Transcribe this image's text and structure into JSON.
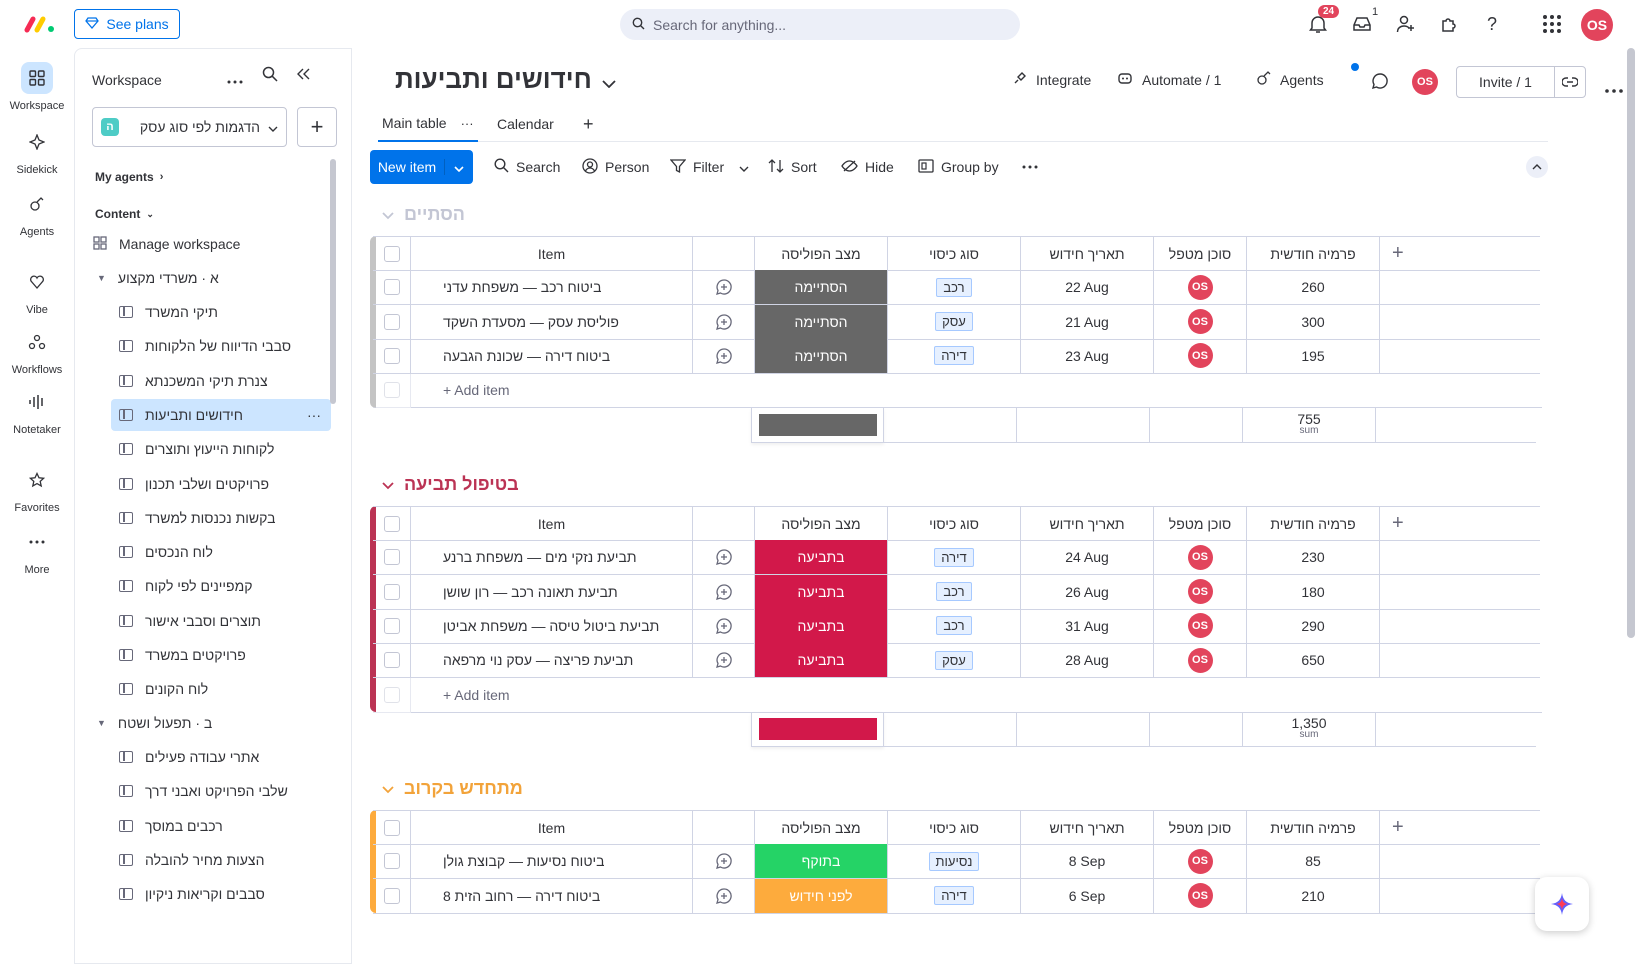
{
  "topbar": {
    "see_plans": "See plans",
    "search_placeholder": "Search for anything...",
    "notif_count": "24",
    "inbox_count": "1",
    "avatar": "OS"
  },
  "leftnav": [
    {
      "label": "Workspace",
      "icon": "workspace-icon"
    },
    {
      "label": "Sidekick",
      "icon": "sidekick-icon"
    },
    {
      "label": "Agents",
      "icon": "agents-icon"
    },
    {
      "label": "Vibe",
      "icon": "vibe-icon"
    },
    {
      "label": "Workflows",
      "icon": "workflows-icon"
    },
    {
      "label": "Notetaker",
      "icon": "notetaker-icon"
    },
    {
      "label": "Favorites",
      "icon": "star-icon"
    },
    {
      "label": "More",
      "icon": "more-icon"
    }
  ],
  "sidebar": {
    "title": "Workspace",
    "workspace_badge": "ה",
    "workspace_name": "הדגמות לפי סוג עסק",
    "my_agents": "My agents",
    "content": "Content",
    "manage": "Manage workspace",
    "folder_a": "א · משרדי מקצוע",
    "folder_b": "ב · תפעול ושטח",
    "items": [
      "תיקי המשרד",
      "סבבי הדיווח של הלקוחות",
      "צנרת תיקי המשכנתא",
      "חידושים ותביעות",
      "לקוחות הייעוץ ותוצרים",
      "פרויקטים ושלבי תכנון",
      "בקשות נכנסות למשרד",
      "לוח הנכסים",
      "קמפיינים לפי לקוח",
      "תוצרים וסבבי אישור",
      "פרויקטים במשרד",
      "לוח הקונים"
    ],
    "items_b": [
      "אתרי עבודה פעילים",
      "שלבי הפרויקט ואבני דרך",
      "רכבים במוסך",
      "הצעות מחיר להובלה",
      "סבבים וקריאות ניקיון"
    ]
  },
  "board": {
    "title": "חידושים ותביעות",
    "integrate": "Integrate",
    "automate": "Automate / 1",
    "agents": "Agents",
    "invite": "Invite / 1",
    "tabs": [
      "Main table",
      "Calendar"
    ],
    "toolbar": {
      "new_item": "New item",
      "search": "Search",
      "person": "Person",
      "filter": "Filter",
      "sort": "Sort",
      "hide": "Hide",
      "group_by": "Group by"
    },
    "columns": [
      "Item",
      "מצב הפוליסה",
      "סוג כיסוי",
      "תאריך חידוש",
      "סוכן מטפל",
      "פרמיה חודשית"
    ],
    "add_item": "+ Add item",
    "sum_label": "sum"
  },
  "groups": [
    {
      "name": "הסתיים",
      "color": "#c4c4c4",
      "title_color": "#c3c6d4",
      "sum": "755",
      "rows": [
        {
          "item": "ביטוח רכב — משפחת עדני",
          "status": "הסתיימה",
          "status_color": "#676767",
          "type": "רכב",
          "date": "22 Aug",
          "owner": "OS",
          "premium": "260"
        },
        {
          "item": "פוליסת עסק — מסעדת השקד",
          "status": "הסתיימה",
          "status_color": "#676767",
          "type": "עסק",
          "date": "21 Aug",
          "owner": "OS",
          "premium": "300"
        },
        {
          "item": "ביטוח דירה — שכונת הגבעה",
          "status": "הסתיימה",
          "status_color": "#676767",
          "type": "דירה",
          "date": "23 Aug",
          "owner": "OS",
          "premium": "195"
        }
      ]
    },
    {
      "name": "בטיפול תביעה",
      "color": "#bb3354",
      "title_color": "#bb3354",
      "sum": "1,350",
      "rows": [
        {
          "item": "תביעת נזקי מים — משפחת ברנע",
          "status": "בתביעה",
          "status_color": "#d2184a",
          "type": "דירה",
          "date": "24 Aug",
          "owner": "OS",
          "premium": "230"
        },
        {
          "item": "תביעת תאונה רכב — רון שושן",
          "status": "בתביעה",
          "status_color": "#d2184a",
          "type": "רכב",
          "date": "26 Aug",
          "owner": "OS",
          "premium": "180"
        },
        {
          "item": "תביעת ביטול טיסה — משפחת אביטן",
          "status": "בתביעה",
          "status_color": "#d2184a",
          "type": "רכב",
          "date": "31 Aug",
          "owner": "OS",
          "premium": "290"
        },
        {
          "item": "תביעת פריצה — עסק נוי מרפאה",
          "status": "בתביעה",
          "status_color": "#d2184a",
          "type": "עסק",
          "date": "28 Aug",
          "owner": "OS",
          "premium": "650"
        }
      ]
    },
    {
      "name": "מתחדש בקרוב",
      "color": "#fdab3d",
      "title_color": "#f2a33a",
      "rows": [
        {
          "item": "ביטוח נסיעות — קבוצת גולן",
          "status": "בתוקף",
          "status_color": "#25d366",
          "type": "נסיעות",
          "date": "8 Sep",
          "owner": "OS",
          "premium": "85"
        },
        {
          "item": "ביטוח דירה — רחוב הזית 8",
          "status": "לפני חידוש",
          "status_color": "#fdab3d",
          "type": "דירה",
          "date": "6 Sep",
          "owner": "OS",
          "premium": "210"
        }
      ]
    }
  ]
}
